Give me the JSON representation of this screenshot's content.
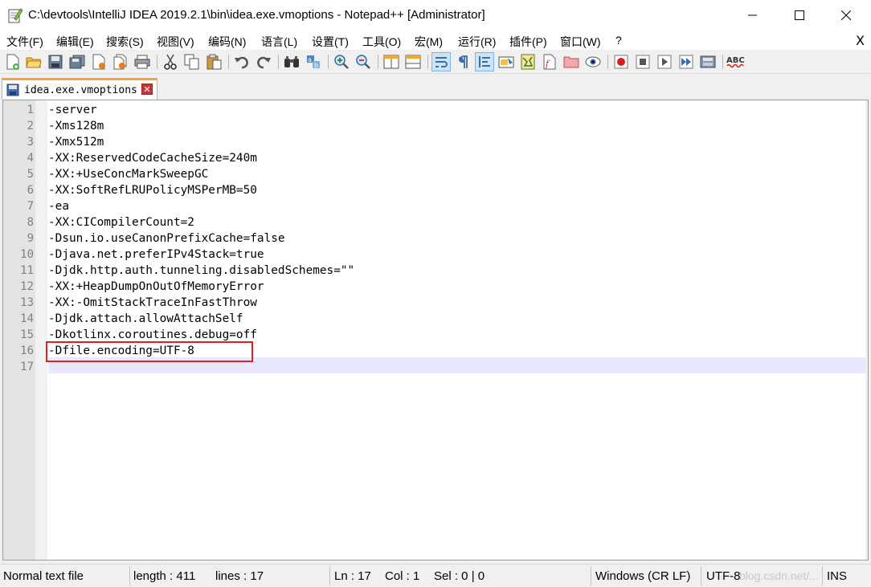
{
  "window": {
    "title": "C:\\devtools\\IntelliJ IDEA 2019.2.1\\bin\\idea.exe.vmoptions - Notepad++ [Administrator]"
  },
  "menu": {
    "items": [
      "文件(F)",
      "编辑(E)",
      "搜索(S)",
      "视图(V)",
      "编码(N)",
      "语言(L)",
      "设置(T)",
      "工具(O)",
      "宏(M)",
      "运行(R)",
      "插件(P)",
      "窗口(W)",
      "?"
    ],
    "close_label": "X"
  },
  "tab": {
    "label": "idea.exe.vmoptions",
    "close_glyph": "✕"
  },
  "editor": {
    "line_numbers": [
      "1",
      "2",
      "3",
      "4",
      "5",
      "6",
      "7",
      "8",
      "9",
      "10",
      "11",
      "12",
      "13",
      "14",
      "15",
      "16",
      "17"
    ],
    "lines": [
      "-server",
      "-Xms128m",
      "-Xmx512m",
      "-XX:ReservedCodeCacheSize=240m",
      "-XX:+UseConcMarkSweepGC",
      "-XX:SoftRefLRUPolicyMSPerMB=50",
      "-ea",
      "-XX:CICompilerCount=2",
      "-Dsun.io.useCanonPrefixCache=false",
      "-Djava.net.preferIPv4Stack=true",
      "-Djdk.http.auth.tunneling.disabledSchemes=\"\"",
      "-XX:+HeapDumpOnOutOfMemoryError",
      "-XX:-OmitStackTraceInFastThrow",
      "-Djdk.attach.allowAttachSelf",
      "-Dkotlinx.coroutines.debug=off",
      "-Dfile.encoding=UTF-8",
      ""
    ]
  },
  "status": {
    "file_type": "Normal text file",
    "length": "length : 411",
    "lines": "lines : 17",
    "ln": "Ln : 17",
    "col": "Col : 1",
    "sel": "Sel : 0 | 0",
    "eol": "Windows (CR LF)",
    "encoding": "UTF-8",
    "mode": "INS",
    "watermark": "blog.csdn.net/..."
  },
  "colors": {
    "tab_accent": "#f7a23a",
    "highlight_box": "#e02020",
    "current_line": "#e8e8ff"
  }
}
